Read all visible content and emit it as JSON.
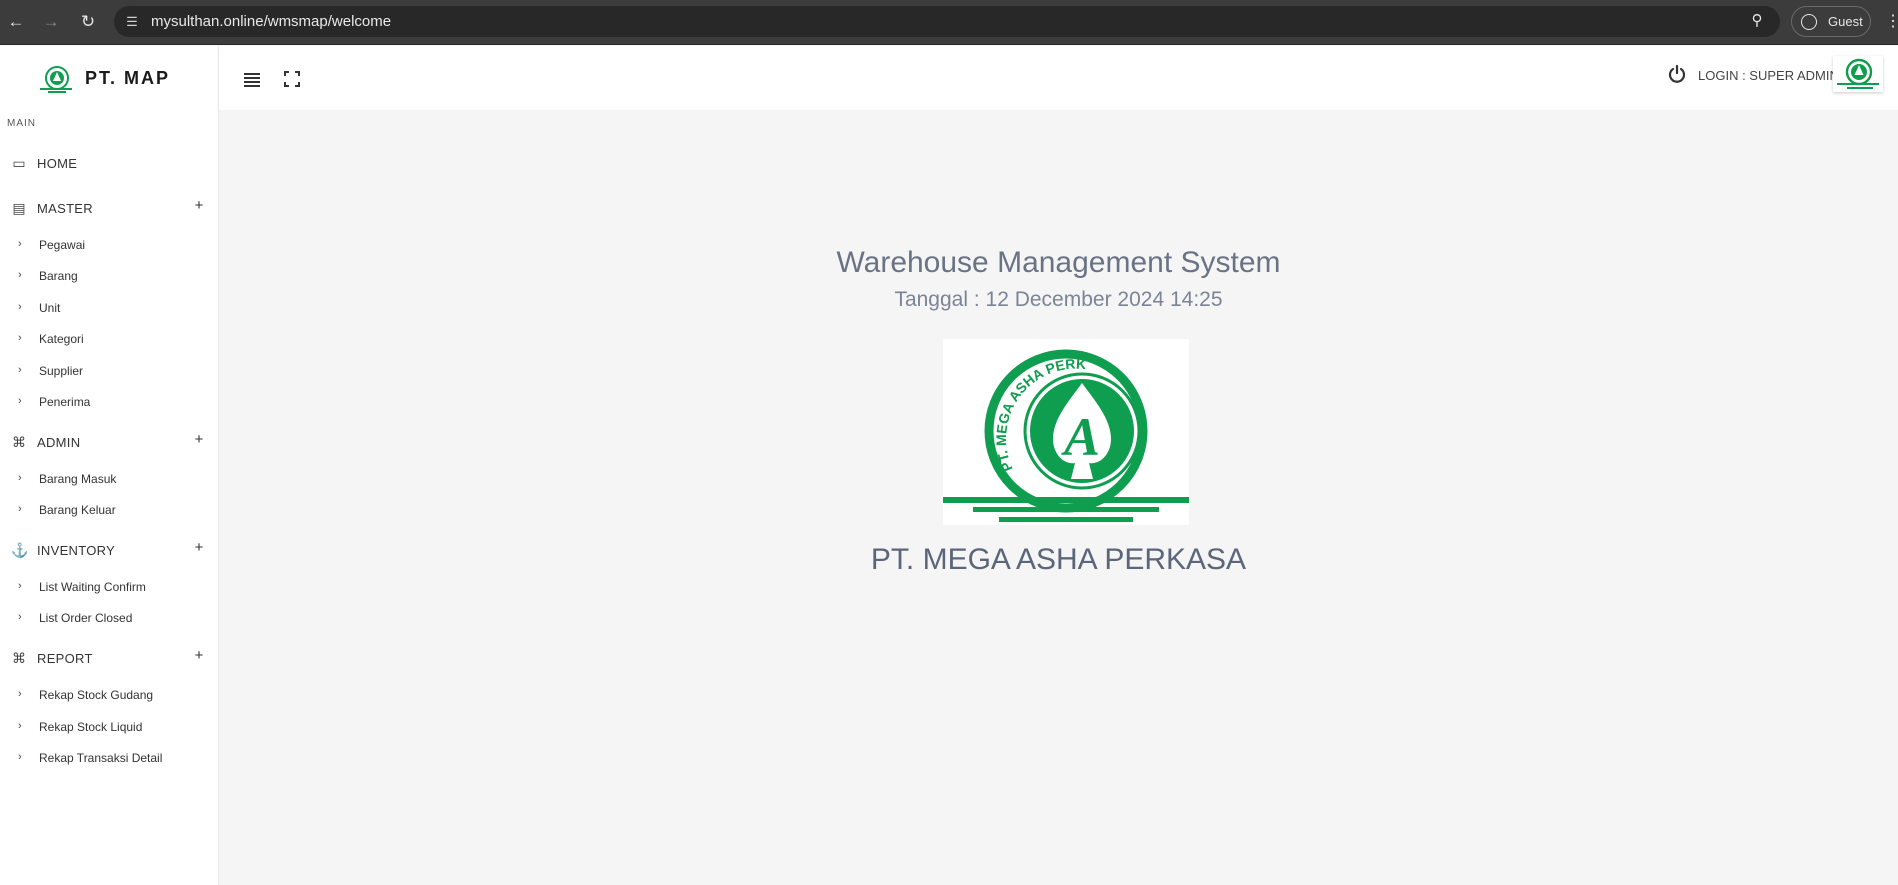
{
  "browser": {
    "url": "mysulthan.online/wmsmap/welcome",
    "profile_label": "Guest",
    "back_icon": "back-arrow-icon",
    "forward_icon": "forward-arrow-icon",
    "reload_icon": "reload-icon",
    "site_info_icon": "tune-icon",
    "zoom_icon": "zoom-icon",
    "menu_icon": "kebab-menu-icon"
  },
  "brand": {
    "name": "PT. MAP",
    "logo_lettering": "PT. MEGA ASHA PERKASA",
    "logo_initial": "A",
    "accent_color": "#0f9d4f"
  },
  "sidebar": {
    "main_label": "MAIN",
    "sections": [
      {
        "label": "HOME",
        "icon": "monitor-icon",
        "expandable": false,
        "items": []
      },
      {
        "label": "MASTER",
        "icon": "briefcase-icon",
        "expandable": true,
        "items": [
          "Pegawai",
          "Barang",
          "Unit",
          "Kategori",
          "Supplier",
          "Penerima"
        ]
      },
      {
        "label": "ADMIN",
        "icon": "command-icon",
        "expandable": true,
        "items": [
          "Barang Masuk",
          "Barang Keluar"
        ]
      },
      {
        "label": "INVENTORY",
        "icon": "anchor-icon",
        "expandable": true,
        "items": [
          "List Waiting Confirm",
          "List Order Closed"
        ]
      },
      {
        "label": "REPORT",
        "icon": "command-icon",
        "expandable": true,
        "items": [
          "Rekap Stock Gudang",
          "Rekap Stock Liquid",
          "Rekap Transaksi Detail"
        ]
      }
    ]
  },
  "topbar": {
    "login_text": "LOGIN : SUPER ADMIN",
    "menu_toggle_icon": "hamburger-icon",
    "fullscreen_icon": "fullscreen-icon",
    "power_icon": "power-icon"
  },
  "main": {
    "title": "Warehouse Management System",
    "date_text": "Tanggal : 12 December 2024 14:25",
    "company_name": "PT. MEGA ASHA PERKASA"
  }
}
